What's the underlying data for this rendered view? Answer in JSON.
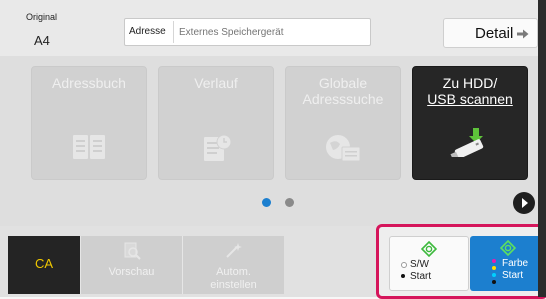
{
  "top_bar": {
    "original_label": "Original",
    "original_value": "A4",
    "address_label": "Adresse",
    "address_placeholder": "Externes Speichergerät",
    "detail_label": "Detail"
  },
  "tiles": [
    {
      "label_line1": "Adressbuch",
      "label_line2": "",
      "enabled": false,
      "icon": "address-book-icon"
    },
    {
      "label_line1": "Verlauf",
      "label_line2": "",
      "enabled": false,
      "icon": "history-icon"
    },
    {
      "label_line1": "Globale",
      "label_line2": "Adresssuche",
      "enabled": false,
      "icon": "global-address-icon"
    },
    {
      "label_line1": "Zu HDD/",
      "label_line2": "USB scannen",
      "enabled": true,
      "icon": "usb-drive-icon"
    }
  ],
  "pager": {
    "current_page": 1,
    "page_count": 2
  },
  "bottom_bar": {
    "ca_label": "CA",
    "preview_label": "Vorschau",
    "auto_label_line1": "Autom.",
    "auto_label_line2": "einstellen"
  },
  "start_buttons": {
    "bw_line1": "S/W",
    "bw_line2": "Start",
    "color_line1": "Farbe",
    "color_line2": "Start"
  },
  "colors": {
    "accent_blue": "#1c7fcf",
    "highlight_frame": "#d5155b",
    "ca_text": "#f0c800",
    "start_green": "#3cb93c"
  }
}
